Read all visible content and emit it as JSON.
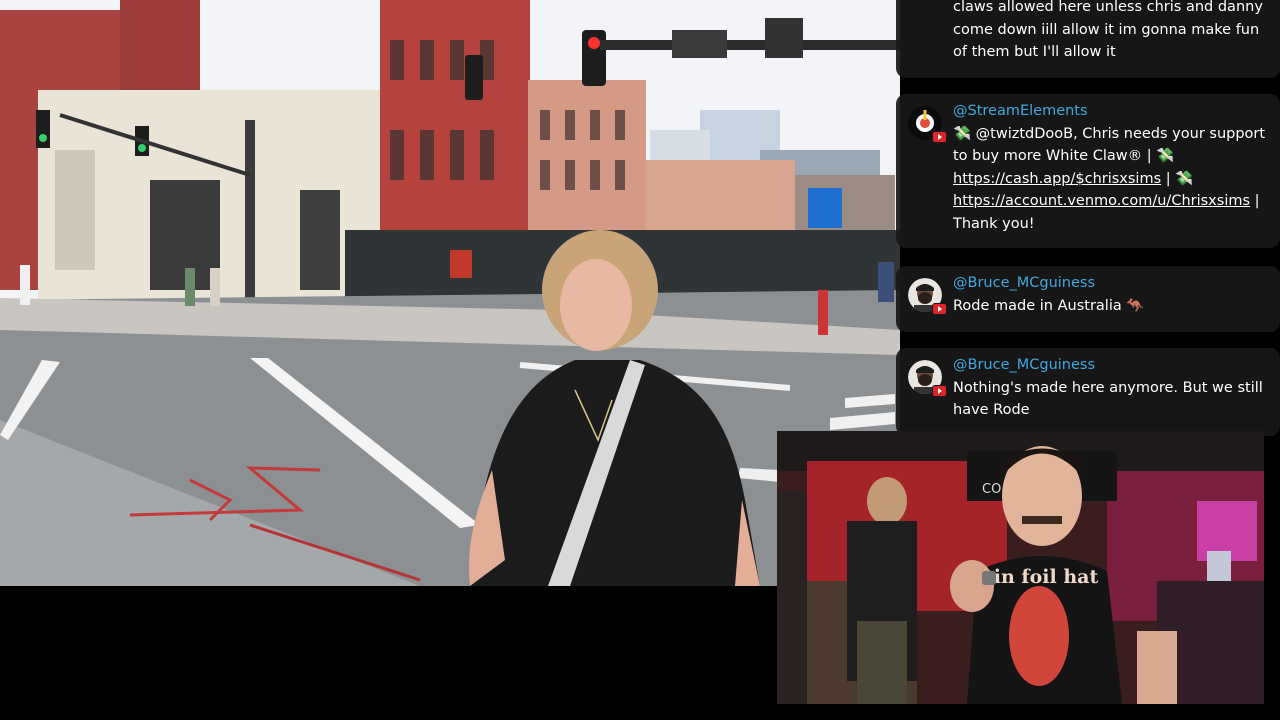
{
  "stream": {
    "main_video": {
      "scene": "street-crosswalk"
    },
    "webcam": {
      "shirt_text": "tin foil hat",
      "wall_text": "CO KE IT"
    }
  },
  "chat": {
    "platform_icon": "youtube-icon",
    "username_color": "#3fa9e0",
    "messages": [
      {
        "username": "",
        "text": "claws allowed here unless chris and danny come down iill allow it im gonna make fun of them but I'll allow it"
      },
      {
        "username": "@StreamElements",
        "intro": "💸 @twiztdDooB, Chris needs your support to buy more White Claw® | 💸",
        "link1": "https://cash.app/$chrisxsims",
        "sep": " | 💸",
        "link2": "https://account.venmo.com/u/Chrisxsims",
        "outro": " | Thank you!"
      },
      {
        "username": "@Bruce_MCguiness",
        "text": "Rode made in Australia 🦘"
      },
      {
        "username": "@Bruce_MCguiness",
        "text": "Nothing's made here anymore. But we still have Rode"
      }
    ]
  }
}
